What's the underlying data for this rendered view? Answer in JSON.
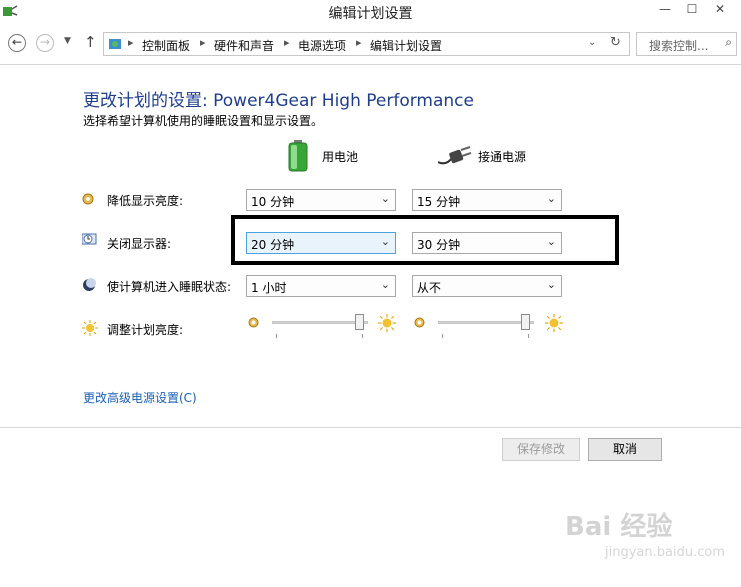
{
  "window": {
    "title": "编辑计划设置",
    "minimize": "—",
    "maximize": "☐",
    "close": "✕"
  },
  "address": {
    "crumbs": [
      "控制面板",
      "硬件和声音",
      "电源选项",
      "编辑计划设置"
    ],
    "search_placeholder": "搜索控制..."
  },
  "content": {
    "heading": "更改计划的设置: Power4Gear High Performance",
    "subtitle": "选择希望计算机使用的睡眠设置和显示设置。",
    "col_battery": "用电池",
    "col_plugged": "接通电源",
    "rows": [
      {
        "label": "降低显示亮度:",
        "battery": "10 分钟",
        "plugged": "15 分钟"
      },
      {
        "label": "关闭显示器:",
        "battery": "20 分钟",
        "plugged": "30 分钟"
      },
      {
        "label": "使计算机进入睡眠状态:",
        "battery": "1 小时",
        "plugged": "从不"
      }
    ],
    "brightness_label": "调整计划亮度:",
    "brightness_battery": 0.95,
    "brightness_plugged": 0.95,
    "advanced_link": "更改高级电源设置(C)"
  },
  "buttons": {
    "save": "保存修改",
    "cancel": "取消"
  },
  "watermark": {
    "text": "Bai 经验",
    "sub": "jingyan.baidu.com"
  }
}
